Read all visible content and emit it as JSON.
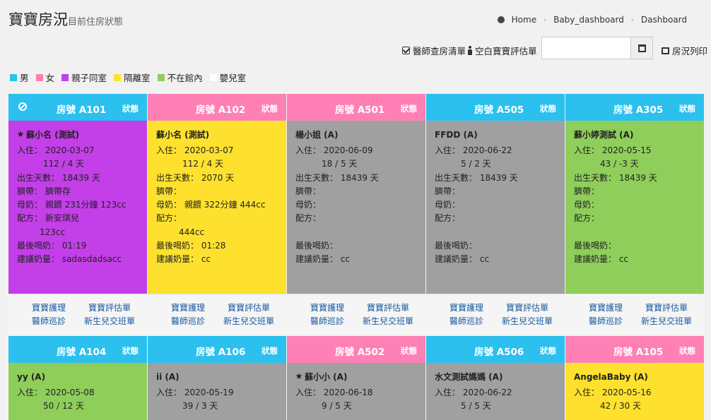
{
  "header": {
    "title": "寶寶房況",
    "subtitle": "目前住房狀態",
    "breadcrumb": [
      "Home",
      "Baby_dashboard",
      "Dashboard"
    ]
  },
  "toolbar": {
    "doctor_list": "醫師查房清單",
    "blank_eval": "空白寶寶評估單",
    "date_value": "",
    "print_label": "房況列印"
  },
  "legend": [
    {
      "label": "男",
      "color": "#2bc0ee"
    },
    {
      "label": "女",
      "color": "#ff80b5"
    },
    {
      "label": "親子同室",
      "color": "#c33fe8"
    },
    {
      "label": "隔離室",
      "color": "#fde12e"
    },
    {
      "label": "不在館內",
      "color": "#8fce5a"
    },
    {
      "label": "嬰兒室",
      "color": "#ffffff"
    }
  ],
  "labels": {
    "status": "狀態",
    "checkin": "入住：",
    "birth_days": "出生天數：",
    "cord": "臍帶：",
    "breastmilk": "母奶：",
    "formula": "配方：",
    "last_feed": "最後喝奶：",
    "suggest": "建議奶量：",
    "care": "寶寶護理",
    "eval": "寶寶評估單",
    "doctor": "醫師巡診",
    "handover": "新生兒交班單"
  },
  "rooms_row1": [
    {
      "room": "房號 A101",
      "head_color": "#2bc0ee",
      "body_color": "#c33fe8",
      "star": true,
      "no_icon": true,
      "name": "蘇小名 (測試)",
      "checkin": "2020-03-07",
      "stay": "112 / 4 天",
      "birth_days": "18439 天",
      "cord": "臍帶存",
      "breastmilk": "親餵 231分鐘 123cc",
      "formula": "新安琪兒",
      "formula2": "123cc",
      "last_feed": "01:19",
      "suggest": "sadasdadsacc"
    },
    {
      "room": "房號 A102",
      "head_color": "#ff80b5",
      "body_color": "#fde12e",
      "star": false,
      "no_icon": false,
      "name": "蘇小名 (測試)",
      "checkin": "2020-03-07",
      "stay": "112 / 4 天",
      "birth_days": "2070 天",
      "cord": "",
      "breastmilk": "親餵 322分鐘 444cc",
      "formula": "",
      "formula2": "444cc",
      "last_feed": "01:28",
      "suggest": "cc"
    },
    {
      "room": "房號 A501",
      "head_color": "#ff80b5",
      "body_color": "#a0a0a0",
      "star": false,
      "no_icon": false,
      "name": "楊小姐 (A)",
      "checkin": "2020-06-09",
      "stay": "18 / 5 天",
      "birth_days": "18439 天",
      "cord": "",
      "breastmilk": "",
      "formula": "",
      "formula2": "",
      "last_feed": "",
      "suggest": "cc"
    },
    {
      "room": "房號 A505",
      "head_color": "#2bc0ee",
      "body_color": "#a0a0a0",
      "star": false,
      "no_icon": false,
      "name": "FFDD (A)",
      "checkin": "2020-06-22",
      "stay": "5 / 2 天",
      "birth_days": "18439 天",
      "cord": "",
      "breastmilk": "",
      "formula": "",
      "formula2": "",
      "last_feed": "",
      "suggest": "cc"
    },
    {
      "room": "房號 A305",
      "head_color": "#2bc0ee",
      "body_color": "#8fce5a",
      "star": false,
      "no_icon": false,
      "name": "蘇小婷測試 (A)",
      "checkin": "2020-05-15",
      "stay": "43 / -3 天",
      "birth_days": "18439 天",
      "cord": "",
      "breastmilk": "",
      "formula": "",
      "formula2": "",
      "last_feed": "",
      "suggest": "cc"
    }
  ],
  "rooms_row2": [
    {
      "room": "房號 A104",
      "head_color": "#2bc0ee",
      "body_color": "#8fce5a",
      "star": false,
      "name": "yy (A)",
      "checkin": "2020-05-08",
      "stay": "50 / 12 天"
    },
    {
      "room": "房號 A106",
      "head_color": "#2bc0ee",
      "body_color": "#a0a0a0",
      "star": false,
      "name": "ii (A)",
      "checkin": "2020-05-19",
      "stay": "39 / 3 天"
    },
    {
      "room": "房號 A502",
      "head_color": "#ff80b5",
      "body_color": "#a0a0a0",
      "star": true,
      "name": "蘇小小 (A)",
      "checkin": "2020-06-18",
      "stay": "9 / 5 天"
    },
    {
      "room": "房號 A506",
      "head_color": "#2bc0ee",
      "body_color": "#a0a0a0",
      "star": false,
      "name": "水文測試媽媽 (A)",
      "checkin": "2020-06-22",
      "stay": "5 / 5 天"
    },
    {
      "room": "房號 A105",
      "head_color": "#ff80b5",
      "body_color": "#fde12e",
      "star": false,
      "name": "AngelaBaby (A)",
      "checkin": "2020-05-16",
      "stay": "42 / 30 天"
    }
  ]
}
